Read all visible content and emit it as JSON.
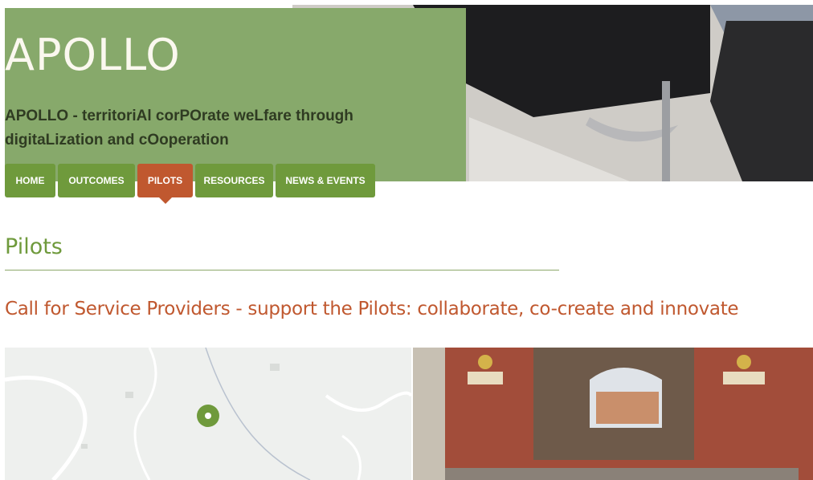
{
  "header": {
    "site_title": "APOLLO",
    "site_subtitle": "APOLLO - territoriAl corPOrate weLfare through digitaLization and cOoperation"
  },
  "nav": {
    "items": [
      {
        "label": "HOME",
        "active": false
      },
      {
        "label": "OUTCOMES",
        "active": false
      },
      {
        "label": "PILOTS",
        "active": true
      },
      {
        "label": "RESOURCES",
        "active": false
      },
      {
        "label": "NEWS & EVENTS",
        "active": false
      }
    ]
  },
  "main": {
    "page_title": "Pilots",
    "article_title": "Call for Service Providers - support the Pilots: collaborate, co-create and innovate"
  },
  "colors": {
    "brand_green": "#87a96b",
    "nav_green": "#6f9a3c",
    "accent_orange": "#c0582f"
  }
}
